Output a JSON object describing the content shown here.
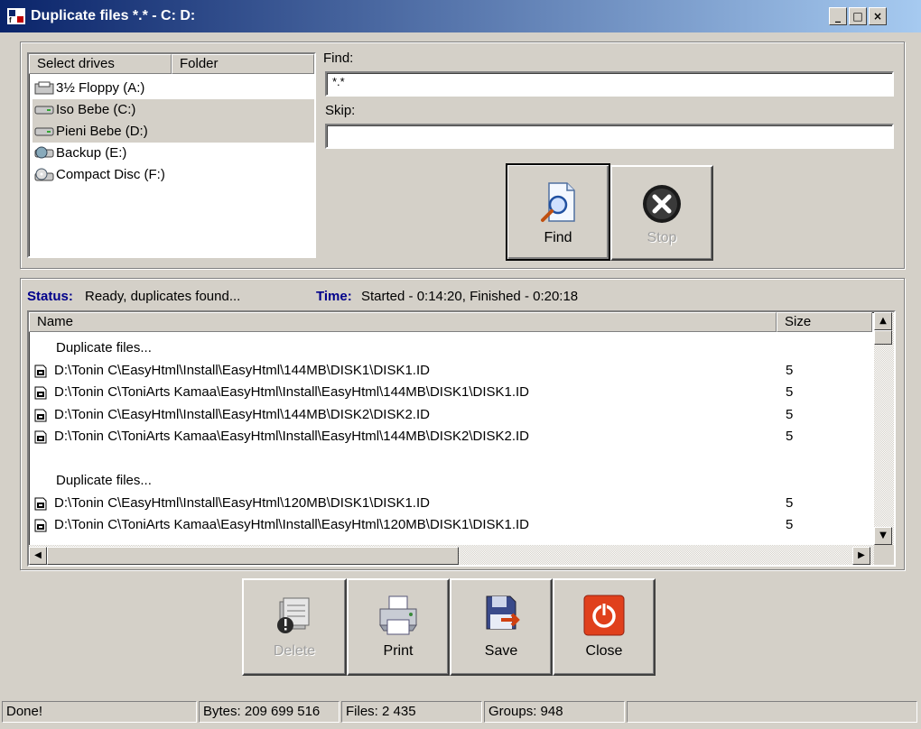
{
  "window": {
    "title": "Duplicate files *.* - C: D:",
    "controls": [
      "_",
      "□",
      "×"
    ]
  },
  "drives": {
    "columns": [
      "Select drives",
      "Folder"
    ],
    "items": [
      {
        "label": "3½ Floppy (A:)",
        "icon": "floppy-drive-icon",
        "selected": false
      },
      {
        "label": "Iso Bebe (C:)",
        "icon": "hard-drive-icon",
        "selected": true
      },
      {
        "label": "Pieni Bebe (D:)",
        "icon": "hard-drive-icon",
        "selected": true
      },
      {
        "label": "Backup (E:)",
        "icon": "network-drive-icon",
        "selected": false
      },
      {
        "label": "Compact Disc (F:)",
        "icon": "cd-drive-icon",
        "selected": false
      }
    ]
  },
  "search": {
    "find_label": "Find:",
    "find_value": "*.*",
    "skip_label": "Skip:",
    "skip_value": ""
  },
  "actions": {
    "find": "Find",
    "stop": "Stop"
  },
  "status": {
    "status_label": "Status:",
    "status_text": "Ready, duplicates found...",
    "time_label": "Time:",
    "time_text": "Started - 0:14:20, Finished - 0:20:18"
  },
  "results": {
    "columns": [
      "Name",
      "Size"
    ],
    "rows": [
      {
        "type": "group",
        "name": "Duplicate files...",
        "size": ""
      },
      {
        "type": "file",
        "name": "D:\\Tonin C\\EasyHtml\\Install\\EasyHtml\\144MB\\DISK1\\DISK1.ID",
        "size": "5"
      },
      {
        "type": "file",
        "name": "D:\\Tonin C\\ToniArts Kamaa\\EasyHtml\\Install\\EasyHtml\\144MB\\DISK1\\DISK1.ID",
        "size": "5"
      },
      {
        "type": "file",
        "name": "D:\\Tonin C\\EasyHtml\\Install\\EasyHtml\\144MB\\DISK2\\DISK2.ID",
        "size": "5"
      },
      {
        "type": "file",
        "name": "D:\\Tonin C\\ToniArts Kamaa\\EasyHtml\\Install\\EasyHtml\\144MB\\DISK2\\DISK2.ID",
        "size": "5"
      },
      {
        "type": "blank",
        "name": "",
        "size": ""
      },
      {
        "type": "group",
        "name": "Duplicate files...",
        "size": ""
      },
      {
        "type": "file",
        "name": "D:\\Tonin C\\EasyHtml\\Install\\EasyHtml\\120MB\\DISK1\\DISK1.ID",
        "size": "5"
      },
      {
        "type": "file",
        "name": "D:\\Tonin C\\ToniArts Kamaa\\EasyHtml\\Install\\EasyHtml\\120MB\\DISK1\\DISK1.ID",
        "size": "5"
      }
    ]
  },
  "bottom_buttons": {
    "delete": "Delete",
    "print": "Print",
    "save": "Save",
    "close": "Close"
  },
  "statusbar": {
    "message": "Done!",
    "bytes": "Bytes: 209 699 516",
    "files": "Files: 2 435",
    "groups": "Groups: 948"
  },
  "colors": {
    "accent_label": "#00008b",
    "close_red": "#e0401c"
  }
}
